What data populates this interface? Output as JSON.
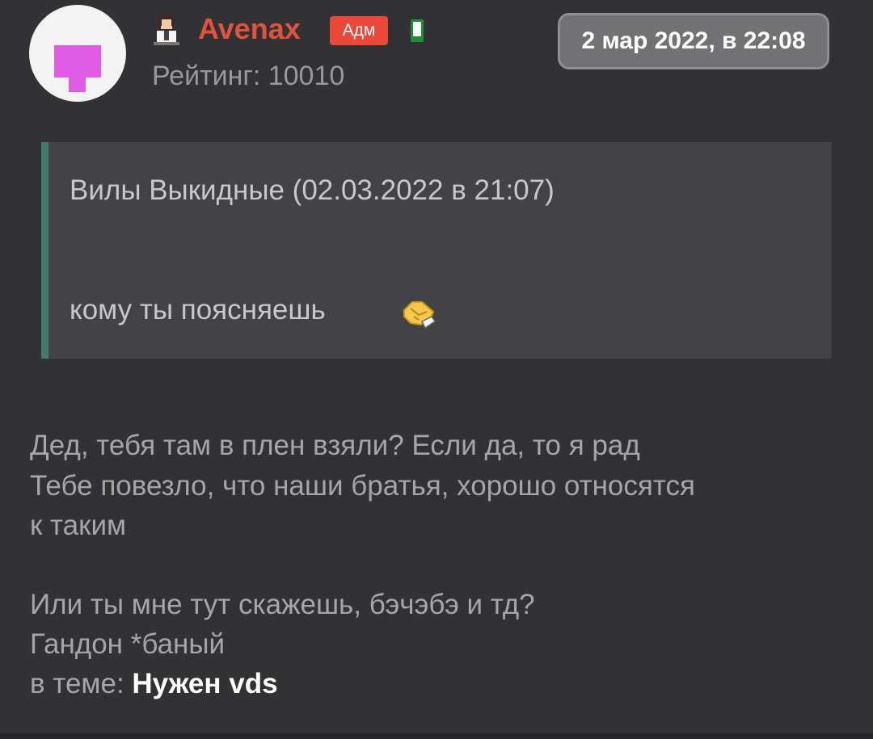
{
  "author": {
    "name": "Avenax",
    "role_badge": "Адм",
    "rating": "Рейтинг: 10010",
    "avatar_color": "#e15ce4",
    "name_color": "#e0533f",
    "online_color": "#2fbf4f"
  },
  "post": {
    "date": "2 мар 2022, в 22:08",
    "quote": {
      "author_line": "Вилы Выкидные (02.03.2022 в 21:07)",
      "text": "кому ты поясняешь",
      "emoji": "handshake-emoji"
    },
    "lines": [
      "Дед, тебя там в плен взяли? Если да, то я рад",
      "Тебе повезло, что наши братья, хорошо относятся",
      "к таким",
      "Или ты мне тут скажешь, бэчэбэ и тд?",
      "Гандон *баный"
    ],
    "topic_prefix": "в теме: ",
    "topic_title": "Нужен vds"
  },
  "icons": {
    "user": "user-icon",
    "online": "online-phone-icon"
  }
}
